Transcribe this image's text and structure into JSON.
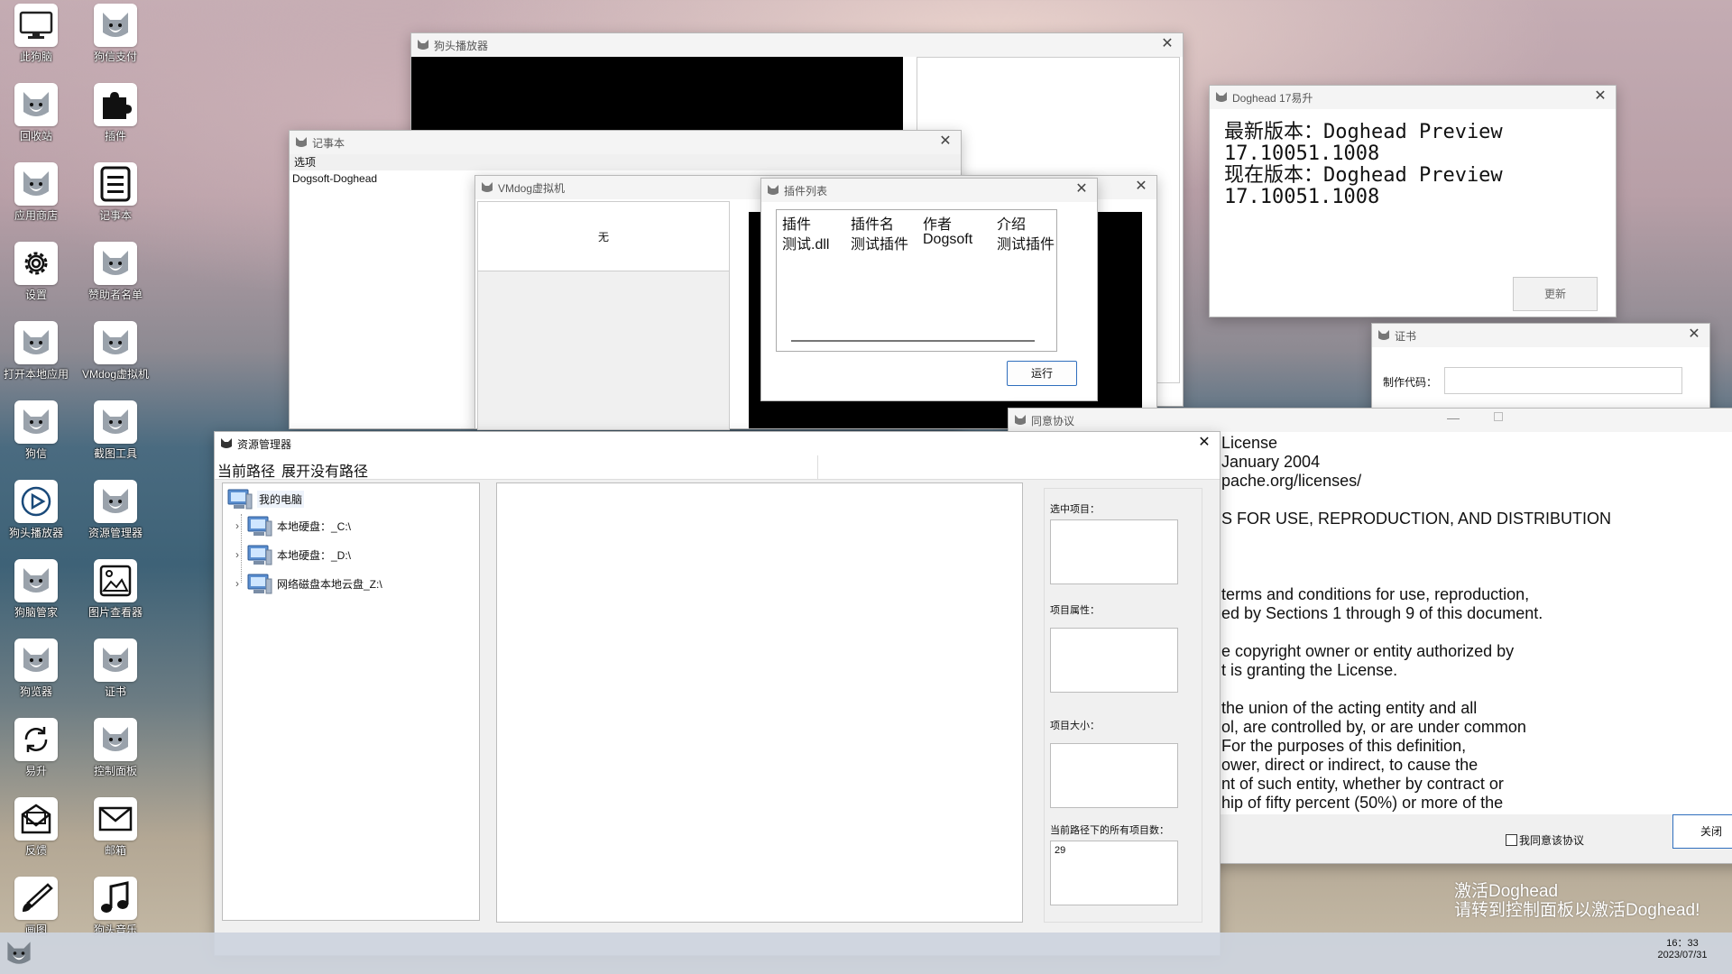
{
  "desktop": {
    "icons": [
      {
        "label": "此狗脑",
        "icon": "monitor-icon"
      },
      {
        "label": "狗信支付",
        "icon": "dog-icon"
      },
      {
        "label": "回收站",
        "icon": "dog-icon"
      },
      {
        "label": "插件",
        "icon": "puzzle-icon"
      },
      {
        "label": "应用商店",
        "icon": "dog-icon"
      },
      {
        "label": "记事本",
        "icon": "notepad-icon"
      },
      {
        "label": "设置",
        "icon": "gear-icon"
      },
      {
        "label": "赞助者名单",
        "icon": "dog-icon"
      },
      {
        "label": "打开本地应用",
        "icon": "dog-icon"
      },
      {
        "label": "VMdog虚拟机",
        "icon": "dog-icon"
      },
      {
        "label": "狗信",
        "icon": "dog-icon"
      },
      {
        "label": "截图工具",
        "icon": "dog-icon"
      },
      {
        "label": "狗头播放器",
        "icon": "play-icon"
      },
      {
        "label": "资源管理器",
        "icon": "dog-icon"
      },
      {
        "label": "狗脑管家",
        "icon": "dog-icon"
      },
      {
        "label": "图片查看器",
        "icon": "image-icon"
      },
      {
        "label": "狗览器",
        "icon": "dog-icon"
      },
      {
        "label": "证书",
        "icon": "dog-icon"
      },
      {
        "label": "易升",
        "icon": "refresh-icon"
      },
      {
        "label": "控制面板",
        "icon": "dog-icon"
      },
      {
        "label": "反馈",
        "icon": "feedback-icon"
      },
      {
        "label": "邮箱",
        "icon": "mail-icon"
      },
      {
        "label": "画图",
        "icon": "brush-icon"
      },
      {
        "label": "狗头音乐",
        "icon": "music-icon"
      }
    ]
  },
  "player": {
    "title": "狗头播放器"
  },
  "notepad": {
    "title": "记事本",
    "menu": "选项",
    "content": "Dogsoft-Doghead"
  },
  "vmdog": {
    "title": "VMdog虚拟机",
    "status": "无"
  },
  "plugins": {
    "title": "插件列表",
    "columns": [
      "插件",
      "插件名",
      "作者",
      "介绍"
    ],
    "rows": [
      [
        "测试.dll",
        "测试插件",
        "Dogsoft",
        "测试插件"
      ]
    ],
    "run_label": "运行"
  },
  "updater": {
    "title": "Doghead 17易升",
    "latest_label": "最新版本：Doghead Preview",
    "latest_ver": "17.10051.1008",
    "current_label": "现在版本：Doghead Preview",
    "current_ver": "17.10051.1008",
    "update_label": "更新"
  },
  "cert": {
    "title": "证书",
    "code_label": "制作代码：",
    "code_value": ""
  },
  "license": {
    "title": "同意协议",
    "lines": [
      "License",
      "January 2004",
      "pache.org/licenses/",
      "",
      "S FOR USE, REPRODUCTION, AND DISTRIBUTION",
      "",
      "",
      "",
      "terms and conditions for use, reproduction,",
      "ed by Sections 1 through 9 of this document.",
      "",
      "e copyright owner or entity authorized by",
      "t is granting the License.",
      "",
      "the union of the acting entity and all",
      "ol, are controlled by, or are under common",
      "For the purposes of this definition,",
      "ower, direct or indirect, to cause the",
      "nt of such entity, whether by contract or",
      "hip of fifty percent (50%) or more of the"
    ],
    "agree_label": "我同意该协议",
    "close_label": "关闭"
  },
  "explorer": {
    "title": "资源管理器",
    "path_label": "当前路径",
    "path_value": "展开没有路径",
    "tree_root": "我的电脑",
    "tree_items": [
      "本地硬盘：_C:\\",
      "本地硬盘：_D:\\",
      "网络磁盘本地云盘_Z:\\"
    ],
    "selected_label": "选中项目：",
    "attr_label": "项目属性：",
    "size_label": "项目大小：",
    "count_label": "当前路径下的所有项目数：",
    "count_value": "29"
  },
  "watermark": {
    "line1": "激活Doghead",
    "line2": "请转到控制面板以激活Doghead!"
  },
  "taskbar": {
    "time": "16：33",
    "date": "2023/07/31"
  },
  "colors": {
    "accent": "#2f6ebd",
    "desktop_top": "#c4acb3",
    "desktop_water": "#3e6277"
  }
}
